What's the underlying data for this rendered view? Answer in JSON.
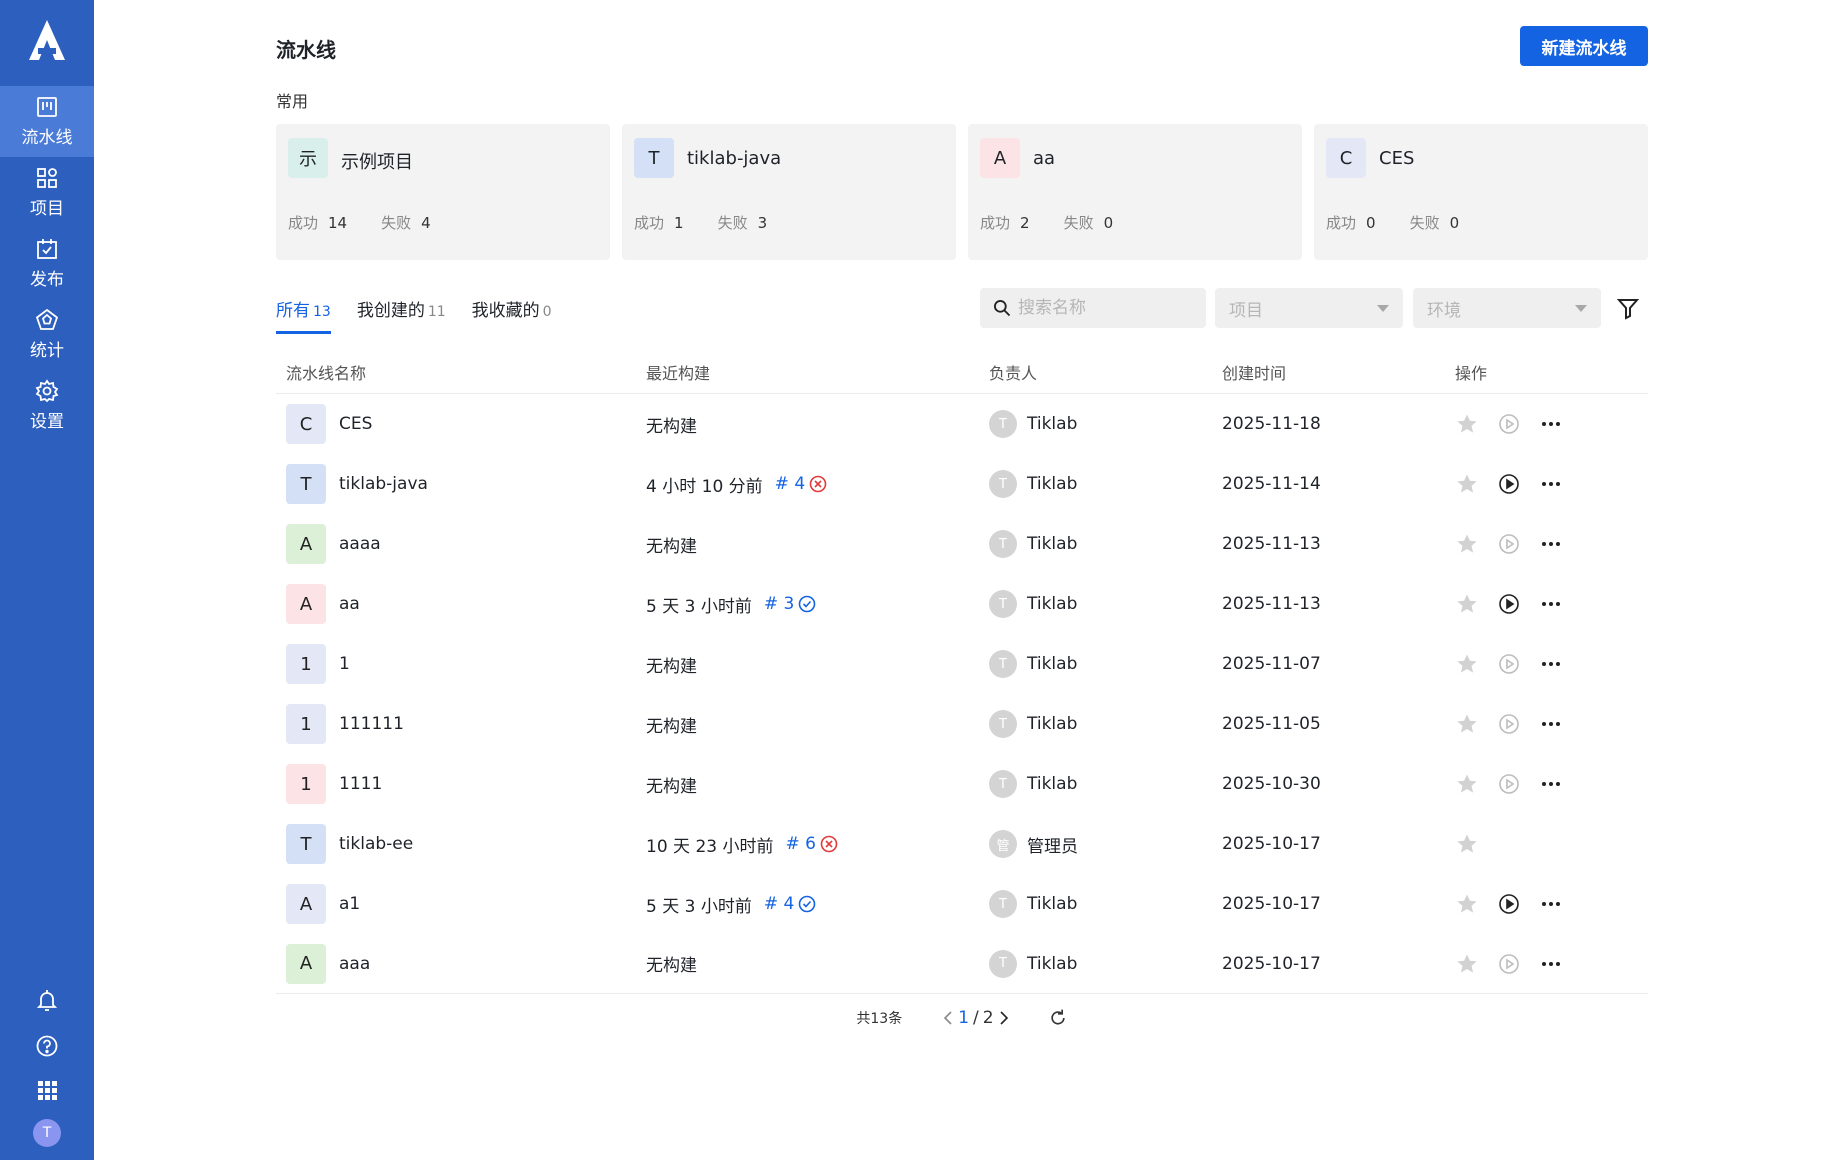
{
  "sidebar": {
    "nav": [
      {
        "label": "流水线",
        "icon": "pipeline-icon",
        "active": true
      },
      {
        "label": "项目",
        "icon": "project-grid-icon",
        "active": false
      },
      {
        "label": "发布",
        "icon": "release-calendar-icon",
        "active": false
      },
      {
        "label": "统计",
        "icon": "statistics-pentagon-icon",
        "active": false
      },
      {
        "label": "设置",
        "icon": "settings-gear-icon",
        "active": false
      }
    ],
    "bottom": [
      "bell-icon",
      "help-icon",
      "apps-grid-icon"
    ],
    "user_initial": "T"
  },
  "header": {
    "title": "流水线",
    "new_button": "新建流水线"
  },
  "common": {
    "label": "常用",
    "success_label": "成功",
    "fail_label": "失败",
    "cards": [
      {
        "initial": "示",
        "name": "示例项目",
        "success": "14",
        "fail": "4",
        "bg": "#d9efec"
      },
      {
        "initial": "T",
        "name": "tiklab-java",
        "success": "1",
        "fail": "3",
        "bg": "#d3e0f5"
      },
      {
        "initial": "A",
        "name": "aa",
        "success": "2",
        "fail": "0",
        "bg": "#fbe3e6"
      },
      {
        "initial": "C",
        "name": "CES",
        "success": "0",
        "fail": "0",
        "bg": "#e4e8f6"
      }
    ]
  },
  "tabs": [
    {
      "label": "所有",
      "count": "13",
      "active": true
    },
    {
      "label": "我创建的",
      "count": "11",
      "active": false
    },
    {
      "label": "我收藏的",
      "count": "0",
      "active": false
    }
  ],
  "filters": {
    "search_placeholder": "搜索名称",
    "project_placeholder": "项目",
    "env_placeholder": "环境"
  },
  "table": {
    "headers": [
      "流水线名称",
      "最近构建",
      "负责人",
      "创建时间",
      "操作"
    ],
    "rows": [
      {
        "initial": "C",
        "bg": "#e4e8f6",
        "name": "CES",
        "build": "无构建",
        "build_num": "",
        "status": "",
        "owner_initial": "T",
        "owner": "Tiklab",
        "created": "2025-11-18",
        "run_enabled": false,
        "has_actions": true
      },
      {
        "initial": "T",
        "bg": "#d3e0f5",
        "name": "tiklab-java",
        "build": "4 小时 10 分前",
        "build_num": "# 4",
        "status": "fail",
        "owner_initial": "T",
        "owner": "Tiklab",
        "created": "2025-11-14",
        "run_enabled": true,
        "has_actions": true
      },
      {
        "initial": "A",
        "bg": "#dcf0d8",
        "name": "aaaa",
        "build": "无构建",
        "build_num": "",
        "status": "",
        "owner_initial": "T",
        "owner": "Tiklab",
        "created": "2025-11-13",
        "run_enabled": false,
        "has_actions": true
      },
      {
        "initial": "A",
        "bg": "#fbe3e6",
        "name": "aa",
        "build": "5 天 3 小时前",
        "build_num": "# 3",
        "status": "success",
        "owner_initial": "T",
        "owner": "Tiklab",
        "created": "2025-11-13",
        "run_enabled": true,
        "has_actions": true
      },
      {
        "initial": "1",
        "bg": "#e4e8f6",
        "name": "1",
        "build": "无构建",
        "build_num": "",
        "status": "",
        "owner_initial": "T",
        "owner": "Tiklab",
        "created": "2025-11-07",
        "run_enabled": false,
        "has_actions": true
      },
      {
        "initial": "1",
        "bg": "#e4e8f6",
        "name": "111111",
        "build": "无构建",
        "build_num": "",
        "status": "",
        "owner_initial": "T",
        "owner": "Tiklab",
        "created": "2025-11-05",
        "run_enabled": false,
        "has_actions": true
      },
      {
        "initial": "1",
        "bg": "#fbe3e6",
        "name": "1111",
        "build": "无构建",
        "build_num": "",
        "status": "",
        "owner_initial": "T",
        "owner": "Tiklab",
        "created": "2025-10-30",
        "run_enabled": false,
        "has_actions": true
      },
      {
        "initial": "T",
        "bg": "#d3e0f5",
        "name": "tiklab-ee",
        "build": "10 天 23 小时前",
        "build_num": "# 6",
        "status": "fail",
        "owner_initial": "管",
        "owner": "管理员",
        "created": "2025-10-17",
        "run_enabled": false,
        "has_actions": false
      },
      {
        "initial": "A",
        "bg": "#e4e8f6",
        "name": "a1",
        "build": "5 天 3 小时前",
        "build_num": "# 4",
        "status": "success",
        "owner_initial": "T",
        "owner": "Tiklab",
        "created": "2025-10-17",
        "run_enabled": true,
        "has_actions": true
      },
      {
        "initial": "A",
        "bg": "#dcf0d8",
        "name": "aaa",
        "build": "无构建",
        "build_num": "",
        "status": "",
        "owner_initial": "T",
        "owner": "Tiklab",
        "created": "2025-10-17",
        "run_enabled": false,
        "has_actions": true
      }
    ]
  },
  "pagination": {
    "total": "共13条",
    "current": "1",
    "separator": "/",
    "pages": "2"
  },
  "colors": {
    "sidebar": "#2d5fbf",
    "primary": "#1463e3",
    "fail": "#e23b3b",
    "success": "#1463e3"
  }
}
